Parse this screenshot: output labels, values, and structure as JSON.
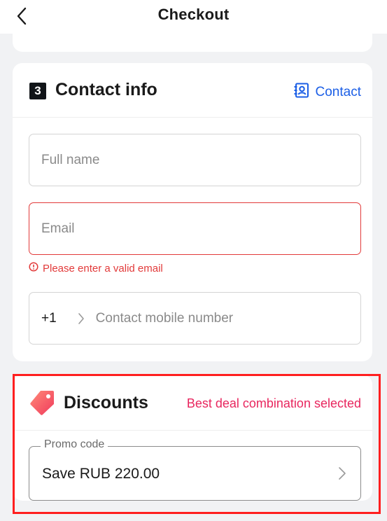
{
  "header": {
    "title": "Checkout",
    "back_icon": "chevron-left-icon"
  },
  "contact_section": {
    "step_number": "3",
    "title": "Contact info",
    "contact_link_label": "Contact",
    "contact_icon": "address-book-icon",
    "full_name_placeholder": "Full name",
    "email_placeholder": "Email",
    "email_error": "Please enter a valid email",
    "phone_country_code": "+1",
    "phone_placeholder": "Contact mobile number"
  },
  "discounts_section": {
    "title": "Discounts",
    "status_text": "Best deal combination selected",
    "promo_label": "Promo code",
    "promo_value": "Save RUB 220.00"
  },
  "colors": {
    "accent_blue": "#1c5fe6",
    "error_red": "#e23a3a",
    "discount_pink": "#e8265e",
    "highlight_red": "#ff1f1f"
  }
}
